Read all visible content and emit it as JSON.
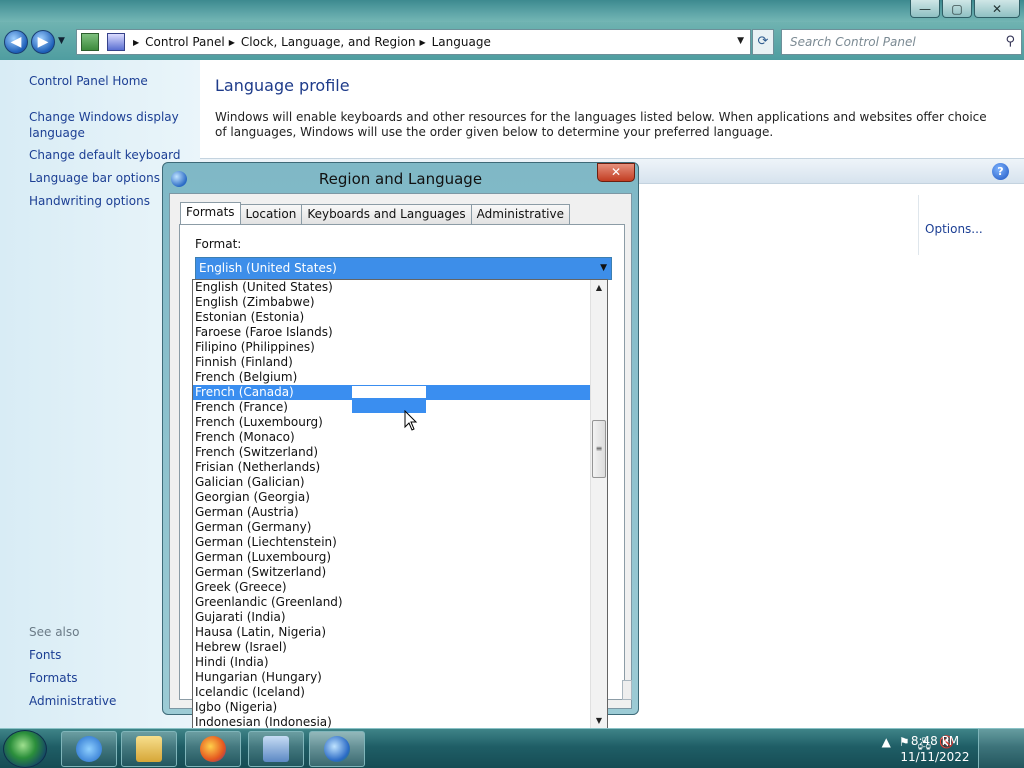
{
  "window": {
    "caption_buttons": [
      "—",
      "▢",
      "✕"
    ]
  },
  "nav": {
    "breadcrumbs": [
      "Control Panel",
      "Clock, Language, and Region",
      "Language"
    ],
    "search_placeholder": "Search Control Panel"
  },
  "left_pane": {
    "items": [
      "Control Panel Home",
      "Change Windows display language",
      "Change default keyboard",
      "Language bar options",
      "Handwriting options"
    ],
    "see_also_label": "See also",
    "see_also": [
      "Fonts",
      "Formats",
      "Administrative"
    ]
  },
  "main": {
    "title": "Language profile",
    "description": "Windows will enable keyboards and other resources for the languages listed below. When applications and websites offer choice of languages, Windows will use the order given below to determine your preferred language.",
    "options_link": "Options...",
    "help_glyph": "?"
  },
  "dialog": {
    "title": "Region and Language",
    "close_glyph": "✕",
    "tabs": [
      "Formats",
      "Location",
      "Keyboards and Languages",
      "Administrative"
    ],
    "active_tab": "Formats",
    "format_label": "Format:",
    "format_value": "English (United States)",
    "dropdown_items": [
      "English (United States)",
      "English (Zimbabwe)",
      "Estonian (Estonia)",
      "Faroese (Faroe Islands)",
      "Filipino (Philippines)",
      "Finnish (Finland)",
      "French (Belgium)",
      "French (Canada)",
      "French (France)",
      "French (Luxembourg)",
      "French (Monaco)",
      "French (Switzerland)",
      "Frisian (Netherlands)",
      "Galician (Galician)",
      "Georgian (Georgia)",
      "German (Austria)",
      "German (Germany)",
      "German (Liechtenstein)",
      "German (Luxembourg)",
      "German (Switzerland)",
      "Greek (Greece)",
      "Greenlandic (Greenland)",
      "Gujarati (India)",
      "Hausa (Latin, Nigeria)",
      "Hebrew (Israel)",
      "Hindi (India)",
      "Hungarian (Hungary)",
      "Icelandic (Iceland)",
      "Igbo (Nigeria)",
      "Indonesian (Indonesia)"
    ],
    "selected_item": "French (Canada)"
  },
  "taskbar": {
    "time": "8:48 PM",
    "date": "11/11/2022",
    "pinned": [
      "internet-explorer",
      "file-explorer",
      "firefox",
      "control-panel",
      "region-and-language"
    ]
  },
  "colors": {
    "selection": "#3a8ef0",
    "link": "#1c3f94"
  }
}
